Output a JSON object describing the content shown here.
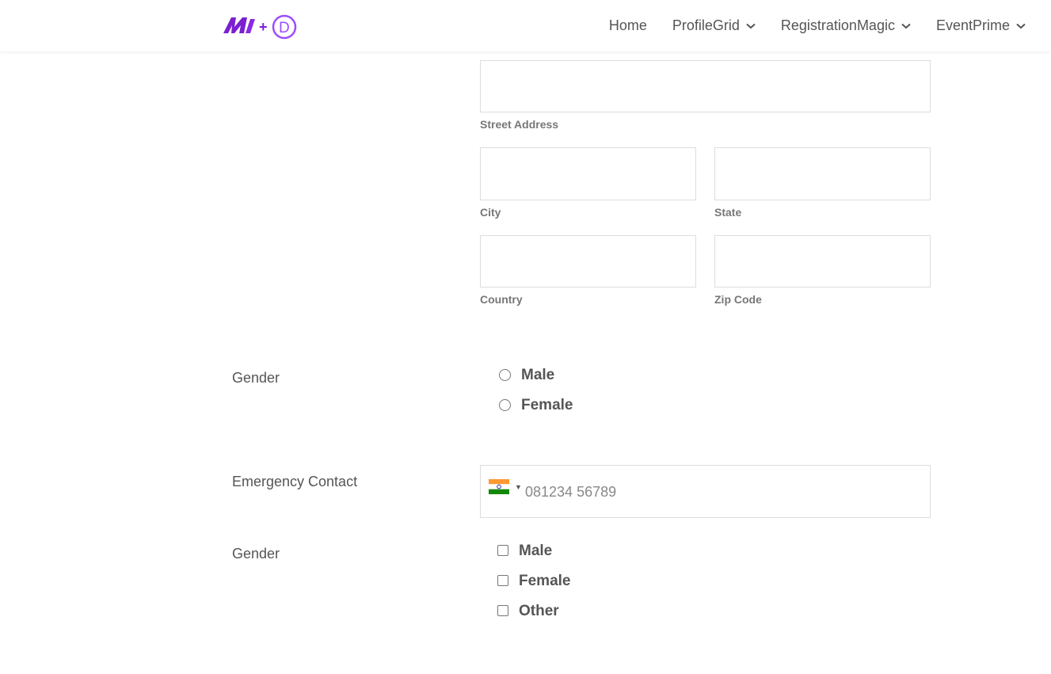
{
  "header": {
    "nav": [
      {
        "label": "Home",
        "has_dropdown": false
      },
      {
        "label": "ProfileGrid",
        "has_dropdown": true
      },
      {
        "label": "RegistrationMagic",
        "has_dropdown": true
      },
      {
        "label": "EventPrime",
        "has_dropdown": true
      }
    ]
  },
  "address": {
    "street_label": "Street Address",
    "city_label": "City",
    "state_label": "State",
    "country_label": "Country",
    "zip_label": "Zip Code"
  },
  "gender_radio": {
    "label": "Gender",
    "options": [
      "Male",
      "Female"
    ]
  },
  "emergency": {
    "label": "Emergency Contact",
    "placeholder": "081234 56789",
    "flag": "india-flag-icon"
  },
  "gender_checkbox": {
    "label": "Gender",
    "options": [
      "Male",
      "Female",
      "Other"
    ]
  },
  "colors": {
    "brand_purple": "#7b1fd1",
    "brand_violet": "#9d4dff",
    "border": "#dddddd",
    "text": "#555555"
  }
}
